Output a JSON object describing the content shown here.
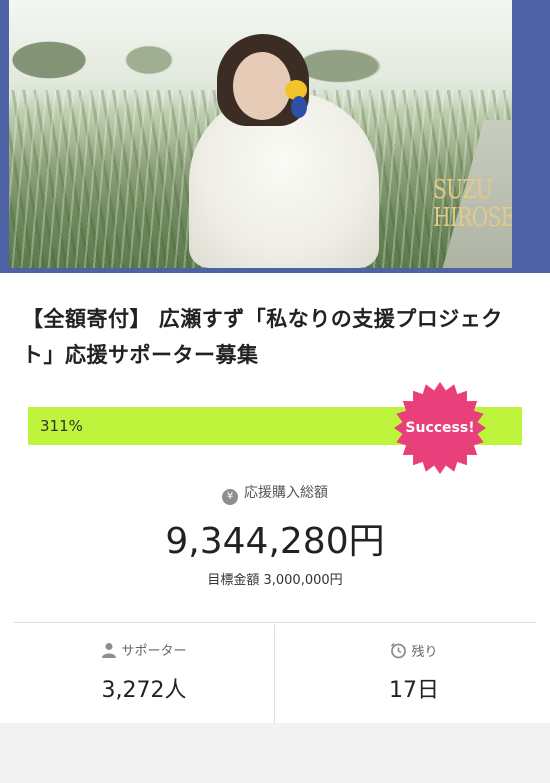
{
  "hero": {
    "logo_line1": "SUZU",
    "logo_line2": "HIROSE",
    "frame_color": "#4e63a6"
  },
  "project": {
    "title": "【全額寄付】 広瀬すず「私なりの支援プロジェクト」応援サポーター募集"
  },
  "progress": {
    "percent_label": "311%",
    "percent_value": 311,
    "badge_label": "Success!",
    "bar_color": "#bef43b",
    "badge_color": "#e93f7b"
  },
  "funding": {
    "label": "応援購入総額",
    "icon": "yen-icon",
    "amount": "9,344,280円",
    "target": "目標金額 3,000,000円"
  },
  "stats": {
    "supporters_label": "サポーター",
    "supporters_value": "3,272人",
    "supporters_icon": "person-icon",
    "remaining_label": "残り",
    "remaining_value": "17日",
    "remaining_icon": "timer-icon"
  }
}
